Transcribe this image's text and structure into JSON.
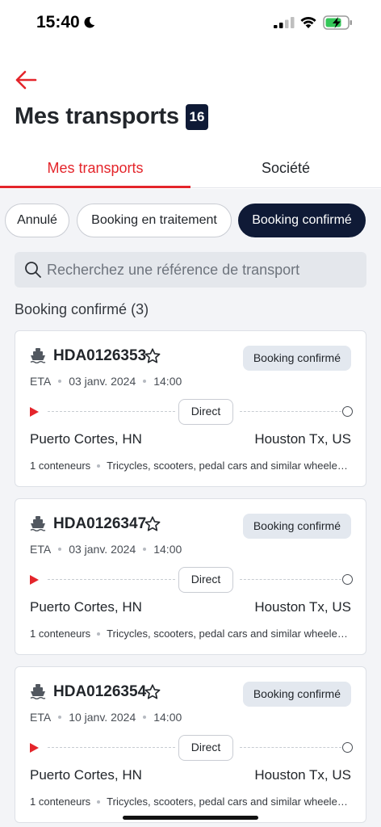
{
  "status_bar": {
    "time": "15:40"
  },
  "header": {
    "title": "Mes transports",
    "count": "16"
  },
  "tabs": [
    {
      "label": "Mes transports",
      "active": true
    },
    {
      "label": "Société",
      "active": false
    }
  ],
  "filters": [
    {
      "label": "Annulé",
      "selected": false
    },
    {
      "label": "Booking en traitement",
      "selected": false
    },
    {
      "label": "Booking confirmé",
      "selected": true
    }
  ],
  "search": {
    "placeholder": "Recherchez une référence de transport"
  },
  "section_title": "Booking confirmé (3)",
  "shipments": [
    {
      "reference": "HDA0126353",
      "status": "Booking confirmé",
      "eta_label": "ETA",
      "date": "03 janv. 2024",
      "time": "14:00",
      "route_type": "Direct",
      "origin": "Puerto Cortes, HN",
      "destination": "Houston Tx, US",
      "containers": "1 conteneurs",
      "goods": "Tricycles, scooters, pedal cars and similar wheeled toys"
    },
    {
      "reference": "HDA0126347",
      "status": "Booking confirmé",
      "eta_label": "ETA",
      "date": "03 janv. 2024",
      "time": "14:00",
      "route_type": "Direct",
      "origin": "Puerto Cortes, HN",
      "destination": "Houston Tx, US",
      "containers": "1 conteneurs",
      "goods": "Tricycles, scooters, pedal cars and similar wheeled toys"
    },
    {
      "reference": "HDA0126354",
      "status": "Booking confirmé",
      "eta_label": "ETA",
      "date": "10 janv. 2024",
      "time": "14:00",
      "route_type": "Direct",
      "origin": "Puerto Cortes, HN",
      "destination": "Houston Tx, US",
      "containers": "1 conteneurs",
      "goods": "Tricycles, scooters, pedal cars and similar wheeled toys"
    }
  ],
  "colors": {
    "accent": "#e4252b",
    "navy": "#0f1a36",
    "background": "#f3f4f7"
  },
  "icons": [
    "moon-icon",
    "signal-icon",
    "wifi-icon",
    "battery-charging-icon",
    "back-arrow-icon",
    "search-icon",
    "ship-icon",
    "star-outline-icon",
    "play-icon",
    "circle-icon"
  ]
}
